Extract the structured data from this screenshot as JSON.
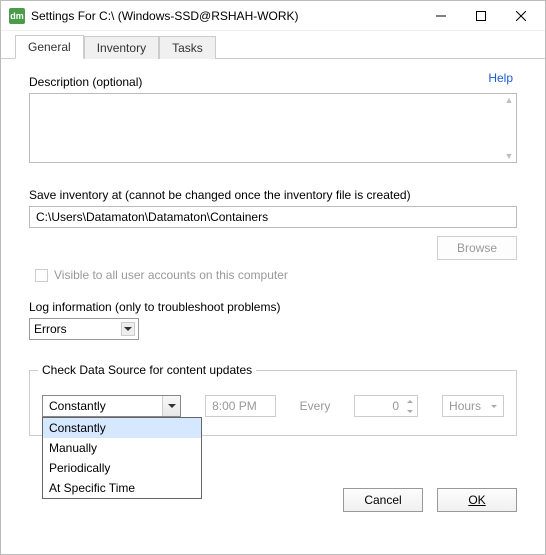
{
  "window": {
    "icon_text": "dm",
    "title": "Settings For C:\\ (Windows-SSD@RSHAH-WORK)"
  },
  "tabs": {
    "general": "General",
    "inventory": "Inventory",
    "tasks": "Tasks"
  },
  "help": "Help",
  "description": {
    "label": "Description (optional)",
    "value": ""
  },
  "save_at": {
    "label": "Save inventory at  (cannot be changed once the inventory file is created)",
    "value": "C:\\Users\\Datamaton\\Datamaton\\Containers",
    "browse": "Browse"
  },
  "visible_all": "Visible to all user accounts on this computer",
  "log": {
    "label": "Log information (only to troubleshoot problems)",
    "value": "Errors"
  },
  "check": {
    "group": "Check Data Source for content updates",
    "freq_selected": "Constantly",
    "options": [
      "Constantly",
      "Manually",
      "Periodically",
      "At Specific Time"
    ],
    "time": "8:00 PM",
    "every": "Every",
    "count": "0",
    "unit": "Hours"
  },
  "buttons": {
    "cancel": "Cancel",
    "ok": "OK"
  }
}
